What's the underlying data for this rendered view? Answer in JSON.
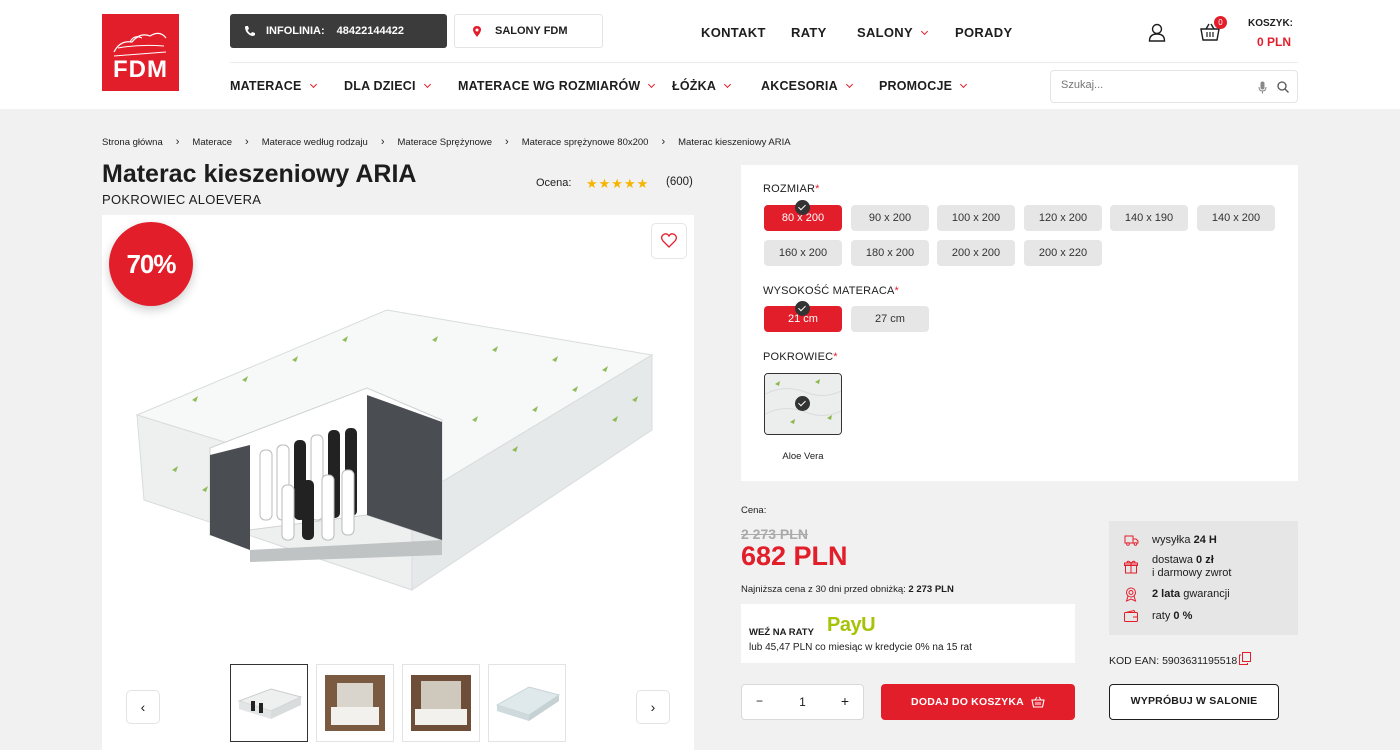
{
  "brand": {
    "logo_text": "FDM",
    "accent": "#e31e2b"
  },
  "header": {
    "hotline_label": "INFOLINIA:",
    "hotline_number": "48422144422",
    "stores_label": "SALONY FDM",
    "top_nav": [
      "KONTAKT",
      "RATY",
      "SALONY",
      "PORADY"
    ],
    "cart_count": "0",
    "cart_label": "KOSZYK:",
    "cart_value": "0 PLN"
  },
  "main_nav": [
    "MATERACE",
    "DLA DZIECI",
    "MATERACE WG ROZMIARÓW",
    "ŁÓŻKA",
    "AKCESORIA",
    "PROMOCJE"
  ],
  "search": {
    "placeholder": "Szukaj..."
  },
  "breadcrumb": [
    "Strona główna",
    "Materace",
    "Materace według rodzaju",
    "Materace Sprężynowe",
    "Materace sprężynowe 80x200",
    "Materac kieszeniowy ARIA"
  ],
  "product": {
    "title": "Materac kieszeniowy ARIA",
    "subtitle": "POKROWIEC ALOEVERA",
    "rating_label": "Ocena:",
    "rating_stars": "★★★★★",
    "rating_value": 5,
    "rating_count": "(600)",
    "discount_badge": "70%"
  },
  "options": {
    "size_label": "ROZMIAR",
    "sizes": [
      "80 x 200",
      "90 x 200",
      "100 x 200",
      "120 x 200",
      "140 x 190",
      "140 x 200",
      "160 x 200",
      "180 x 200",
      "200 x 200",
      "200 x 220"
    ],
    "selected_size": "80 x 200",
    "height_label": "WYSOKOŚĆ MATERACA",
    "heights": [
      "21 cm",
      "27 cm"
    ],
    "selected_height": "21 cm",
    "cover_label": "POKROWIEC",
    "covers": [
      "Aloe Vera"
    ],
    "required_mark": "*"
  },
  "price": {
    "label": "Cena:",
    "old": "2 273 PLN",
    "new": "682 PLN",
    "lowest_text": "Najniższa cena z 30 dni przed obniżką:",
    "lowest_value": "2 273 PLN"
  },
  "installments": {
    "title": "WEŹ NA RATY",
    "provider": "PayU",
    "text": "lub 45,47 PLN co miesiąc w kredycie 0% na 15 rat"
  },
  "perks": {
    "shipping": {
      "text": "wysyłka",
      "bold": "24 H"
    },
    "delivery": {
      "text": "dostawa",
      "bold": "0 zł",
      "line2": "i darmowy zwrot"
    },
    "warranty": {
      "bold": "2 lata",
      "text": "gwarancji"
    },
    "raty": {
      "text": "raty",
      "bold": "0 %"
    }
  },
  "ean": "KOD EAN: 5903631195518",
  "cart_controls": {
    "minus": "−",
    "qty": "1",
    "plus": "+",
    "add_label": "DODAJ DO KOSZYKA",
    "try_label": "WYPRÓBUJ W SALONIE"
  },
  "gallery_nav": {
    "prev": "‹",
    "next": "›"
  }
}
